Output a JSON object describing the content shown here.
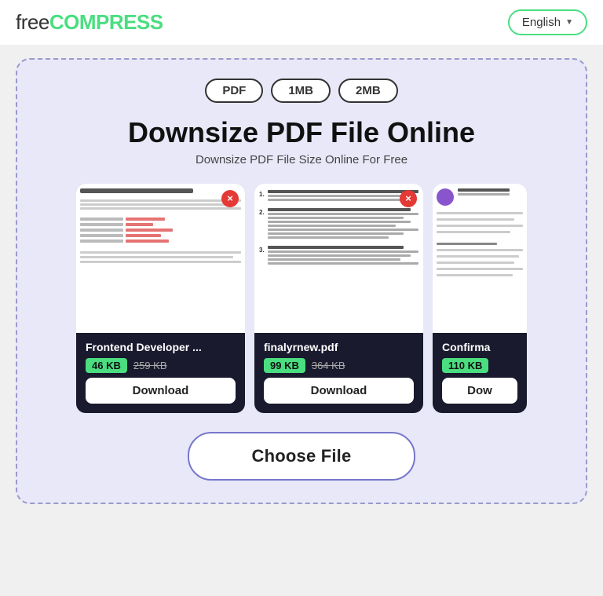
{
  "header": {
    "logo_free": "free",
    "logo_compress": "COMPRESS",
    "lang_label": "English",
    "lang_chevron": "▼"
  },
  "hero": {
    "tag1": "PDF",
    "tag2": "1MB",
    "tag3": "2MB",
    "title": "Downsize PDF File Online",
    "subtitle": "Downsize PDF File Size Online For Free"
  },
  "cards": [
    {
      "filename": "Frontend Developer ...",
      "size_new": "46 KB",
      "size_old": "259 KB",
      "download_label": "Download",
      "close_label": "×"
    },
    {
      "filename": "finalyrnew.pdf",
      "size_new": "99 KB",
      "size_old": "364 KB",
      "download_label": "Download",
      "close_label": "×"
    },
    {
      "filename": "Confirma",
      "size_new": "110 KB",
      "size_old": "",
      "download_label": "Dow",
      "close_label": "×"
    }
  ],
  "choose_file": {
    "label": "Choose File"
  }
}
